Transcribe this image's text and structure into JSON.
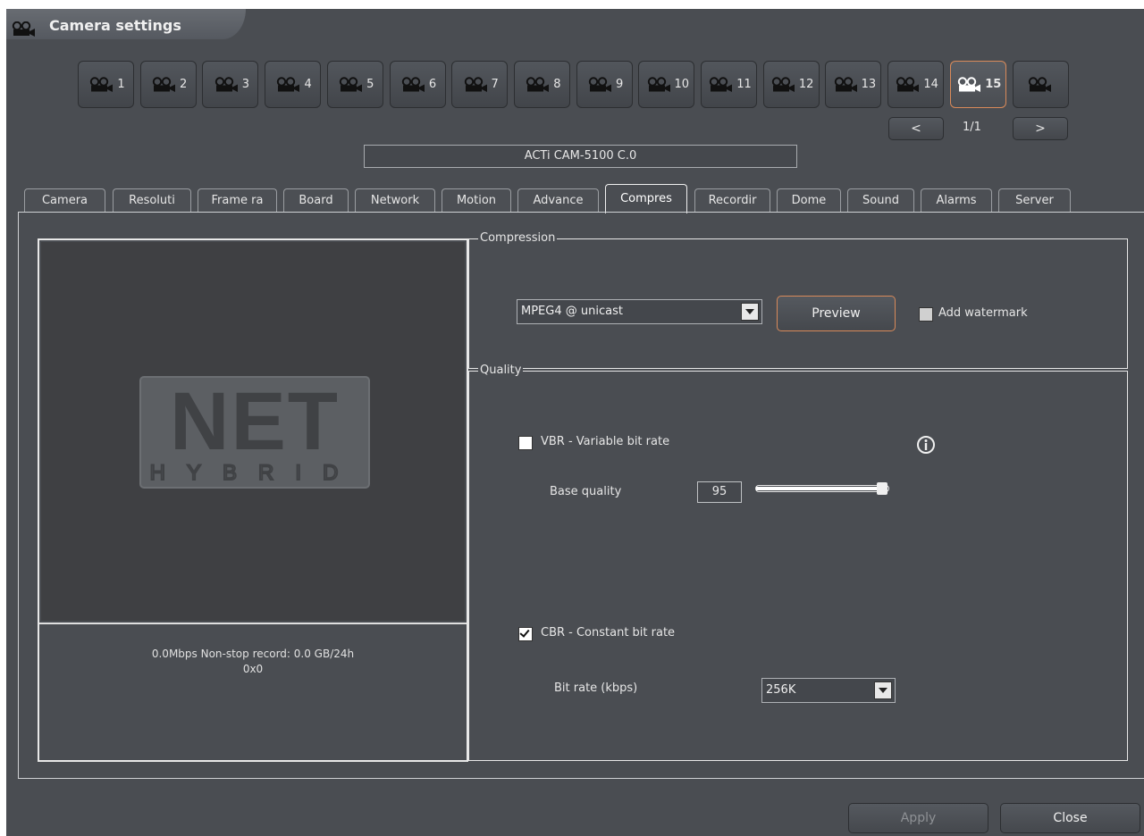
{
  "window": {
    "title": "Camera settings"
  },
  "camera_buttons": [
    {
      "label": "1",
      "active": false
    },
    {
      "label": "2",
      "active": false
    },
    {
      "label": "3",
      "active": false
    },
    {
      "label": "4",
      "active": false
    },
    {
      "label": "5",
      "active": false
    },
    {
      "label": "6",
      "active": false
    },
    {
      "label": "7",
      "active": false
    },
    {
      "label": "8",
      "active": false
    },
    {
      "label": "9",
      "active": false
    },
    {
      "label": "10",
      "active": false
    },
    {
      "label": "11",
      "active": false
    },
    {
      "label": "12",
      "active": false
    },
    {
      "label": "13",
      "active": false
    },
    {
      "label": "14",
      "active": false
    },
    {
      "label": "15",
      "active": true
    },
    {
      "label": "",
      "active": false
    }
  ],
  "pager": {
    "prev": "<",
    "next": ">",
    "page": "1/1"
  },
  "camera_name": "ACTi CAM-5100 C.0",
  "tabs": [
    {
      "label": "Camera",
      "active": false
    },
    {
      "label": "Resoluti",
      "active": false
    },
    {
      "label": "Frame ra",
      "active": false
    },
    {
      "label": "Board",
      "active": false
    },
    {
      "label": "Network",
      "active": false
    },
    {
      "label": "Motion",
      "active": false
    },
    {
      "label": "Advance",
      "active": false
    },
    {
      "label": "Compres",
      "active": true
    },
    {
      "label": "Recordir",
      "active": false
    },
    {
      "label": "Dome",
      "active": false
    },
    {
      "label": "Sound",
      "active": false
    },
    {
      "label": "Alarms",
      "active": false
    },
    {
      "label": "Server",
      "active": false
    }
  ],
  "preview": {
    "stats_line1": "0.0Mbps  Non-stop record: 0.0 GB/24h",
    "stats_line2": "0x0",
    "logo_text": "NET",
    "logo_subtext": "HYBRID"
  },
  "compression": {
    "group_label": "Compression",
    "codec": "MPEG4 @ unicast",
    "preview_button": "Preview",
    "watermark_label": "Add watermark",
    "watermark_checked": false
  },
  "quality": {
    "group_label": "Quality",
    "vbr_label": "VBR - Variable bit rate",
    "vbr_checked": false,
    "base_quality_label": "Base quality",
    "base_quality_value": "95",
    "base_quality_fraction": 0.95,
    "cbr_label": "CBR - Constant bit rate",
    "cbr_checked": true,
    "bitrate_label": "Bit rate (kbps)",
    "bitrate_value": "256K"
  },
  "footer": {
    "apply": "Apply",
    "close": "Close"
  },
  "colors": {
    "background": "#4a4d52",
    "accent": "#d98a5a"
  }
}
